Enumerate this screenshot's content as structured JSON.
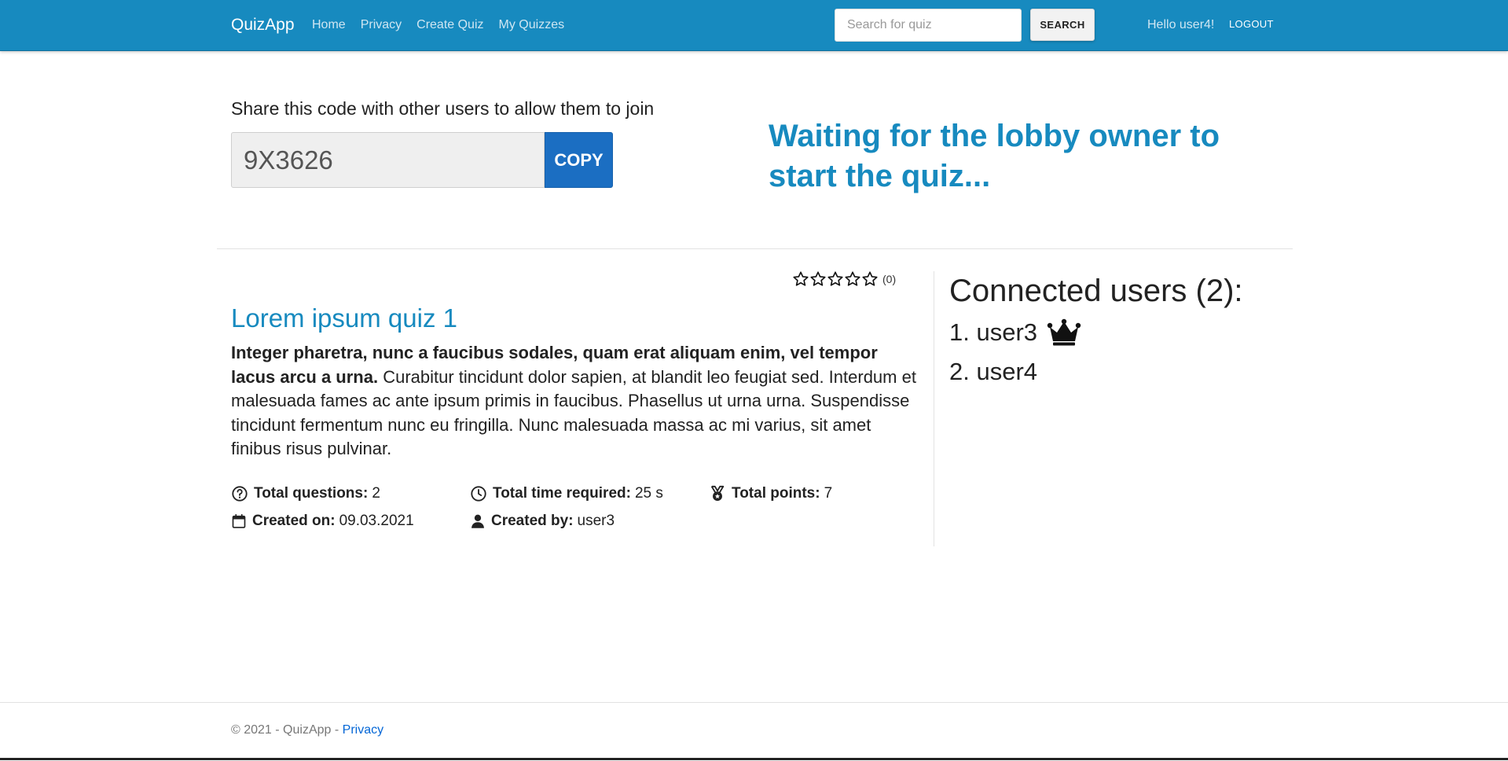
{
  "nav": {
    "brand": "QuizApp",
    "links": [
      "Home",
      "Privacy",
      "Create Quiz",
      "My Quizzes"
    ],
    "search_placeholder": "Search for quiz",
    "search_button": "SEARCH",
    "greeting": "Hello user4!",
    "logout": "LOGOUT"
  },
  "share": {
    "label": "Share this code with other users to allow them to join",
    "code": "9X3626",
    "copy_button": "COPY"
  },
  "waiting_message": "Waiting for the lobby owner to start the quiz...",
  "quiz": {
    "rating_stars": 0,
    "rating_count": "(0)",
    "title": "Lorem ipsum quiz 1",
    "description_bold": "Integer pharetra, nunc a faucibus sodales, quam erat aliquam enim, vel tempor lacus arcu a urna.",
    "description_rest": " Curabitur tincidunt dolor sapien, at blandit leo feugiat sed. Interdum et malesuada fames ac ante ipsum primis in faucibus. Phasellus ut urna urna. Suspendisse tincidunt fermentum nunc eu fringilla. Nunc malesuada massa ac mi varius, sit amet finibus risus pulvinar.",
    "total_questions_label": "Total questions:",
    "total_questions": "2",
    "total_time_label": "Total time required:",
    "total_time": "25 s",
    "total_points_label": "Total points:",
    "total_points": "7",
    "created_on_label": "Created on:",
    "created_on": "09.03.2021",
    "created_by_label": "Created by:",
    "created_by": "user3"
  },
  "users": {
    "title": "Connected users (2):",
    "list": [
      {
        "label": "1. user3",
        "owner": true
      },
      {
        "label": "2. user4",
        "owner": false
      }
    ]
  },
  "footer": {
    "text": "© 2021 - QuizApp - ",
    "link": "Privacy"
  },
  "colors": {
    "navbar": "#178abf",
    "accent": "#178abf",
    "copy_button": "#1b6ec2"
  },
  "icons": {
    "rating": "star-outline-icon",
    "questions": "question-circle-icon",
    "time": "clock-icon",
    "points": "medal-icon",
    "created_on": "calendar-icon",
    "created_by": "user-icon",
    "owner": "crown-icon"
  }
}
